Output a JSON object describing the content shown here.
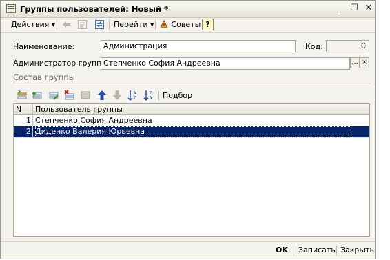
{
  "window": {
    "title": "Группы пользователей: Новый *"
  },
  "toolbar": {
    "actions": "Действия",
    "goto": "Перейти",
    "tips": "Советы",
    "help": "?"
  },
  "form": {
    "name_label": "Наименование:",
    "name_value": "Администрация",
    "code_label": "Код:",
    "code_value": "0",
    "admin_label": "Администратор группы:",
    "admin_value": "Степченко София Андреевна",
    "select_btn": "...",
    "clear_btn": "×"
  },
  "section": {
    "title": "Состав группы",
    "selection": "Подбор"
  },
  "table": {
    "columns": [
      "N",
      "Пользователь группы"
    ],
    "rows": [
      {
        "n": "1",
        "user": "Степченко София Андреевна"
      },
      {
        "n": "2",
        "user": "Диденко Валерия Юрьевна"
      }
    ]
  },
  "footer": {
    "ok": "OK",
    "save": "Записать",
    "close": "Закрыть"
  },
  "colors": {
    "selection": "#0a246a",
    "window_bg": "#f4f3ee"
  }
}
